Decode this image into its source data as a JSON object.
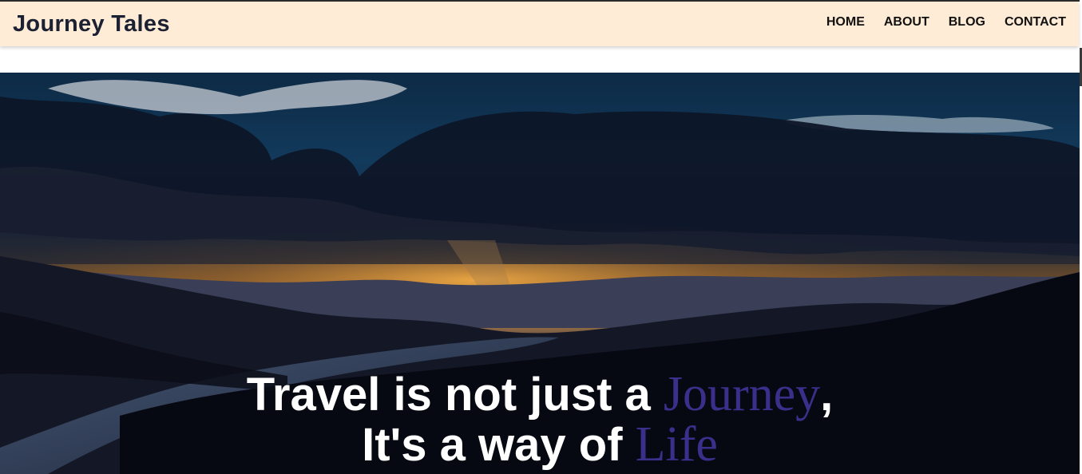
{
  "header": {
    "logo": "Journey Tales",
    "nav": [
      {
        "label": "HOME"
      },
      {
        "label": "ABOUT"
      },
      {
        "label": "BLOG"
      },
      {
        "label": "CONTACT"
      }
    ]
  },
  "hero": {
    "image_description_icon": "landscape-sunset-image",
    "line1_start": "Travel is not just a ",
    "line1_accent": "Journey",
    "line1_end": ",",
    "line2_start": "It's a way of ",
    "line2_accent": "Life"
  },
  "colors": {
    "navbar_bg": "#ffecd6",
    "logo": "#1c2033",
    "accent": "#3b2f8c",
    "hero_text": "#ffffff"
  }
}
